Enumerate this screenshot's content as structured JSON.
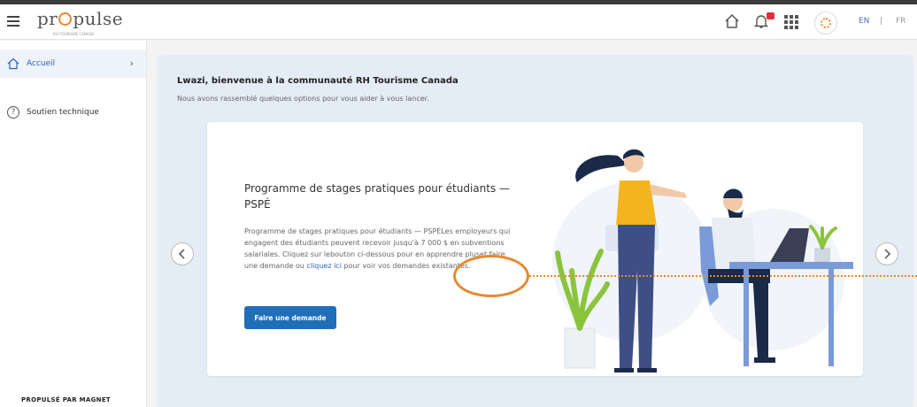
{
  "header": {
    "logo": "propulse",
    "logo_subtitle": "RH TOURISME CANADA",
    "lang_en": "EN",
    "lang_sep": "|",
    "lang_fr": "FR",
    "notification_badge": "1"
  },
  "sidebar": {
    "items": [
      {
        "label": "Accueil",
        "icon": "home-icon",
        "active": true
      },
      {
        "label": "Soutien technique",
        "icon": "help-icon",
        "active": false
      }
    ],
    "powered_by": "PROPULSÉ PAR MAGNET"
  },
  "main": {
    "welcome_title": "Lwazi, bienvenue à la communauté RH Tourisme Canada",
    "welcome_subtitle": "Nous avons rassemblé quelques options pour vous aider à vous lancer.",
    "card": {
      "title": "Programme de stages pratiques pour étudiants — PSPÉ",
      "body_part1": "Programme de stages pratiques pour étudiants — PSPÉLes employeurs qui engagent des étudiants peuvent recevoir jusqu'à 7 000 $ en subventions salariales. Cliquez sur lebouton ci-dessous pour en apprendre pluset faire une demande ou ",
      "body_link": "cliquez ici",
      "body_part2": " pour voir vos demandes existantes.",
      "cta_label": "Faire une demande"
    }
  },
  "colors": {
    "accent": "#1f6fb8",
    "annotation": "#e8892e",
    "panel_bg": "#e4edf6"
  }
}
